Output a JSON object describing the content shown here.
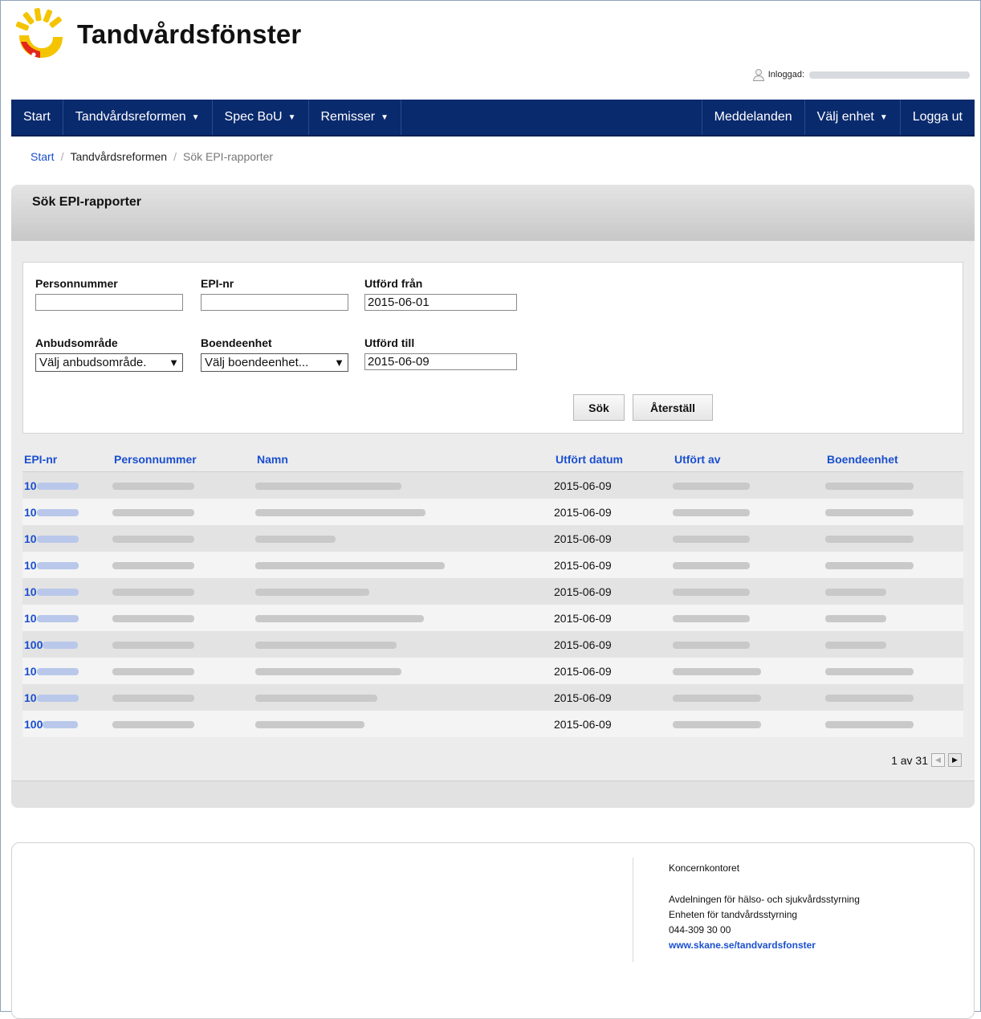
{
  "header": {
    "app_title": "Tandvårdsfönster",
    "login_label": "Inloggad:"
  },
  "nav": {
    "items": [
      {
        "label": "Start",
        "dropdown": false
      },
      {
        "label": "Tandvårdsreformen",
        "dropdown": true
      },
      {
        "label": "Spec BoU",
        "dropdown": true
      },
      {
        "label": "Remisser",
        "dropdown": true
      }
    ],
    "right_items": [
      {
        "label": "Meddelanden",
        "dropdown": false
      },
      {
        "label": "Välj enhet",
        "dropdown": true
      },
      {
        "label": "Logga ut",
        "dropdown": false
      }
    ]
  },
  "breadcrumb": {
    "start": "Start",
    "section": "Tandvårdsreformen",
    "current": "Sök EPI-rapporter",
    "separator": "/"
  },
  "panel": {
    "title": "Sök EPI-rapporter"
  },
  "form": {
    "personnummer": {
      "label": "Personnummer",
      "value": ""
    },
    "epi_nr": {
      "label": "EPI-nr",
      "value": ""
    },
    "utford_fran": {
      "label": "Utförd från",
      "value": "2015-06-01"
    },
    "anbudsomrade": {
      "label": "Anbudsområde",
      "selected": "Välj anbudsområde."
    },
    "boendeenhet": {
      "label": "Boendeenhet",
      "selected": "Välj boendeenhet..."
    },
    "utford_till": {
      "label": "Utförd till",
      "value": "2015-06-09"
    },
    "search_label": "Sök",
    "reset_label": "Återställ"
  },
  "table": {
    "headers": [
      "EPI-nr",
      "Personnummer",
      "Namn",
      "Utfört datum",
      "Utfört av",
      "Boendeenhet"
    ],
    "rows": [
      {
        "epi_prefix": "10",
        "date": "2015-06-09"
      },
      {
        "epi_prefix": "10",
        "date": "2015-06-09"
      },
      {
        "epi_prefix": "10",
        "date": "2015-06-09"
      },
      {
        "epi_prefix": "10",
        "date": "2015-06-09"
      },
      {
        "epi_prefix": "10",
        "date": "2015-06-09"
      },
      {
        "epi_prefix": "10",
        "date": "2015-06-09"
      },
      {
        "epi_prefix": "100",
        "date": "2015-06-09"
      },
      {
        "epi_prefix": "10",
        "date": "2015-06-09"
      },
      {
        "epi_prefix": "10",
        "date": "2015-06-09"
      },
      {
        "epi_prefix": "100",
        "date": "2015-06-09"
      }
    ]
  },
  "pager": {
    "text": "1 av 31"
  },
  "footer": {
    "org": "Koncernkontoret",
    "line1": "Avdelningen för hälso- och sjukvårdsstyrning",
    "line2": "Enheten för tandvårdsstyrning",
    "phone": "044-309 30 00",
    "link": "www.skane.se/tandvardsfonster"
  },
  "colors": {
    "nav_bg": "#0a2a6e",
    "link": "#1a4fcf",
    "logo_yellow": "#f5c400",
    "logo_red": "#e3261c"
  }
}
